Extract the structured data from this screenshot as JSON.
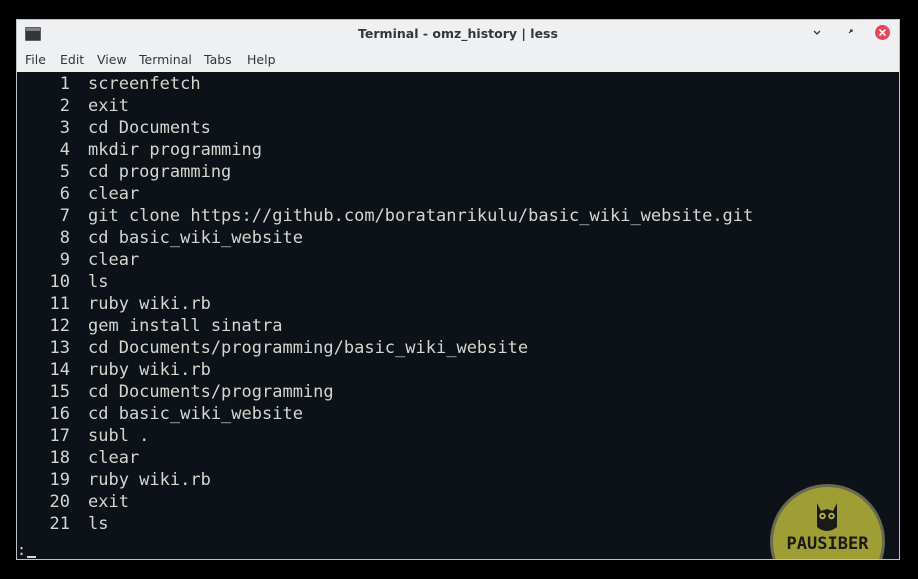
{
  "window": {
    "title": "Terminal - omz_history | less"
  },
  "menu": [
    "File",
    "Edit",
    "View",
    "Terminal",
    "Tabs",
    "Help"
  ],
  "lines": [
    {
      "n": "1",
      "text": "screenfetch"
    },
    {
      "n": "2",
      "text": "exit"
    },
    {
      "n": "3",
      "text": "cd Documents"
    },
    {
      "n": "4",
      "text": "mkdir programming"
    },
    {
      "n": "5",
      "text": "cd programming"
    },
    {
      "n": "6",
      "text": "clear"
    },
    {
      "n": "7",
      "text": "git clone https://github.com/boratanrikulu/basic_wiki_website.git"
    },
    {
      "n": "8",
      "text": "cd basic_wiki_website"
    },
    {
      "n": "9",
      "text": "clear"
    },
    {
      "n": "10",
      "text": "ls"
    },
    {
      "n": "11",
      "text": "ruby wiki.rb"
    },
    {
      "n": "12",
      "text": "gem install sinatra"
    },
    {
      "n": "13",
      "text": "cd Documents/programming/basic_wiki_website"
    },
    {
      "n": "14",
      "text": "ruby wiki.rb"
    },
    {
      "n": "15",
      "text": "cd Documents/programming"
    },
    {
      "n": "16",
      "text": "cd basic_wiki_website"
    },
    {
      "n": "17",
      "text": "subl ."
    },
    {
      "n": "18",
      "text": "clear"
    },
    {
      "n": "19",
      "text": "ruby wiki.rb"
    },
    {
      "n": "20",
      "text": "exit"
    },
    {
      "n": "21",
      "text": "ls"
    }
  ],
  "prompt": ":",
  "watermark": {
    "text": "PAUSIBER"
  },
  "icons": {
    "app": "terminal-icon",
    "minimize": "chevron-down-icon",
    "maximize": "restore-icon",
    "close": "close-icon",
    "watermark": "owl-icon"
  },
  "colors": {
    "terminal_bg": "#0d1218",
    "terminal_fg": "#d3d7cf",
    "window_chrome": "#eff0f1",
    "close_button": "#e5475a",
    "logo_fill": "#b9b73a"
  }
}
